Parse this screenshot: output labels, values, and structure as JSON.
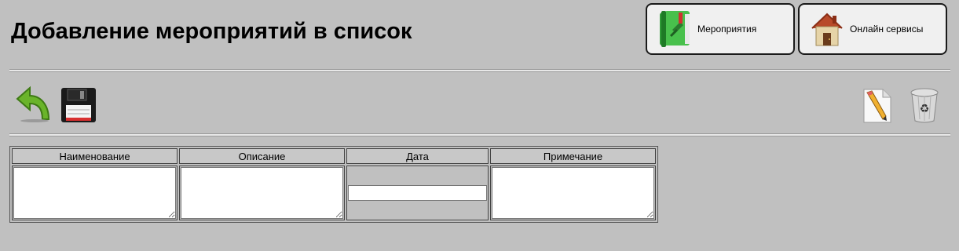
{
  "header": {
    "title": "Добавление мероприятий в список"
  },
  "nav": {
    "events_label": "Мероприятия",
    "events_icon": "green-book-icon",
    "services_label": "Онлайн сервисы",
    "services_icon": "house-icon"
  },
  "toolbar": {
    "back_icon": "back-arrow-icon",
    "save_icon": "floppy-disk-icon",
    "edit_icon": "pencil-document-icon",
    "delete_icon": "recycle-bin-icon"
  },
  "form": {
    "columns": [
      "Наименование",
      "Описание",
      "Дата",
      "Примечание"
    ],
    "name_value": "",
    "description_value": "",
    "date_value": "",
    "note_value": ""
  },
  "colors": {
    "background": "#c0c0c0",
    "button_face": "#f0f0f0"
  }
}
